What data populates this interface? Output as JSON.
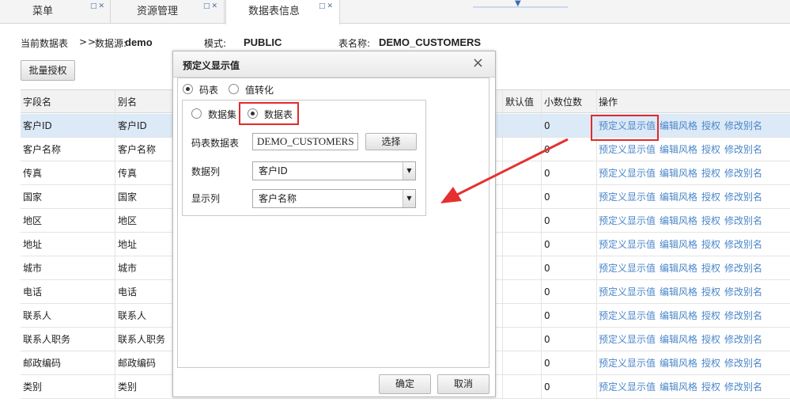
{
  "tabs": [
    {
      "label": "菜单"
    },
    {
      "label": "资源管理"
    },
    {
      "label": "数据表信息"
    }
  ],
  "tab_controls": {
    "restore": "□",
    "close": "✕"
  },
  "info": {
    "current_table_label": "当前数据表",
    "path_sep": ">>",
    "datasource_label": "数据源:",
    "datasource_value": "demo",
    "mode_label": "模式:",
    "mode_value": "PUBLIC",
    "table_label": "表名称:",
    "table_value": "DEMO_CUSTOMERS"
  },
  "toolbar": {
    "batch_grant": "批量授权"
  },
  "table": {
    "headers": {
      "name": "字段名",
      "alias": "别名",
      "default": "默认值",
      "decimals": "小数位数",
      "ops": "操作"
    },
    "actions": [
      "预定义显示值",
      "编辑风格",
      "授权",
      "修改别名"
    ],
    "rows": [
      {
        "name": "客户ID",
        "alias": "客户ID",
        "decimals": "0"
      },
      {
        "name": "客户名称",
        "alias": "客户名称",
        "decimals": "0"
      },
      {
        "name": "传真",
        "alias": "传真",
        "decimals": "0"
      },
      {
        "name": "国家",
        "alias": "国家",
        "decimals": "0"
      },
      {
        "name": "地区",
        "alias": "地区",
        "decimals": "0"
      },
      {
        "name": "地址",
        "alias": "地址",
        "decimals": "0"
      },
      {
        "name": "城市",
        "alias": "城市",
        "decimals": "0"
      },
      {
        "name": "电话",
        "alias": "电话",
        "decimals": "0"
      },
      {
        "name": "联系人",
        "alias": "联系人",
        "decimals": "0"
      },
      {
        "name": "联系人职务",
        "alias": "联系人职务",
        "decimals": "0"
      },
      {
        "name": "邮政编码",
        "alias": "邮政编码",
        "decimals": "0"
      },
      {
        "name": "类别",
        "alias": "类别",
        "decimals": "0"
      }
    ]
  },
  "dialog": {
    "title": "预定义显示值",
    "close": "×",
    "type_options": {
      "code_table": "码表",
      "value_convert": "值转化"
    },
    "source_options": {
      "dataset": "数据集",
      "datatable": "数据表"
    },
    "code_table_label": "码表数据表",
    "code_table_value": "DEMO_CUSTOMERS",
    "choose_button": "选择",
    "data_column_label": "数据列",
    "data_column_value": "客户ID",
    "display_column_label": "显示列",
    "display_column_value": "客户名称",
    "ok_button": "确定",
    "cancel_button": "取消"
  },
  "colors": {
    "highlight": "#e02b2b",
    "link": "#4a86c8",
    "selected_row": "#dce9f7"
  }
}
